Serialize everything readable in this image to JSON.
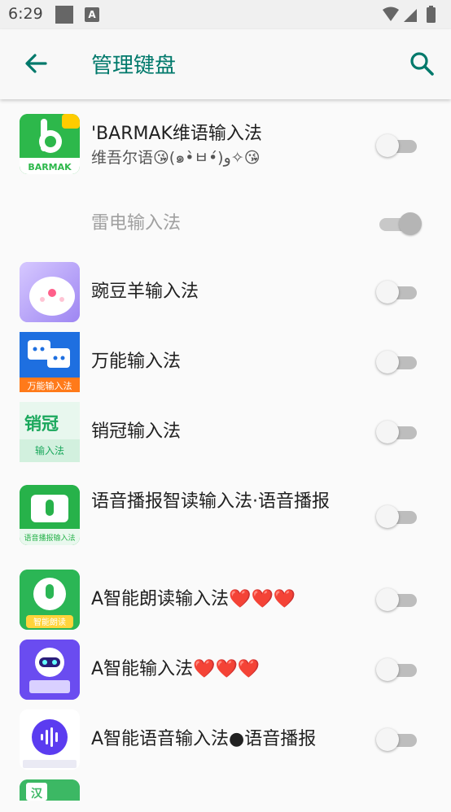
{
  "status_bar": {
    "time": "6:29"
  },
  "app_bar": {
    "title": "管理键盘"
  },
  "keyboards": [
    {
      "name": "'BARMAK维语输入法",
      "subtitle": "维吾尔语😘(๑•̀ㅂ•́)و✧😘",
      "icon": "barmak-app-icon",
      "icon_text": "BARMAK",
      "enabled": false
    },
    {
      "name": "雷电输入法",
      "icon": "none",
      "enabled": true,
      "disabled": true
    },
    {
      "name": "豌豆羊输入法",
      "icon": "sheep-app-icon",
      "enabled": false
    },
    {
      "name": "万能输入法",
      "icon": "chat-bubbles-app-icon",
      "icon_text": "万能输入法",
      "enabled": false
    },
    {
      "name": "销冠输入法",
      "icon": "xiaoguan-app-icon",
      "icon_text_top": "销冠",
      "icon_text_bottom": "输入法",
      "enabled": false
    },
    {
      "name": "语音播报智读输入法·语音播报",
      "icon": "microphone-app-icon",
      "icon_text": "语音播报输入法",
      "enabled": false
    },
    {
      "name": "A智能朗读输入法❤️❤️❤️",
      "icon": "reader-app-icon",
      "icon_text": "智能朗读",
      "enabled": false
    },
    {
      "name": "A智能输入法❤️❤️❤️",
      "icon": "robot-app-icon",
      "enabled": false
    },
    {
      "name": "A智能语音输入法●语音播报",
      "icon": "voice-wave-app-icon",
      "enabled": false
    },
    {
      "name": "",
      "icon": "han-app-icon",
      "icon_text": "汉",
      "enabled": false
    }
  ],
  "colors": {
    "accent": "#00796b",
    "barmak_green": "#2db84b",
    "chat_blue": "#1e6fe0",
    "mic_green": "#27b24a",
    "robot_purple": "#6a4cf0"
  }
}
